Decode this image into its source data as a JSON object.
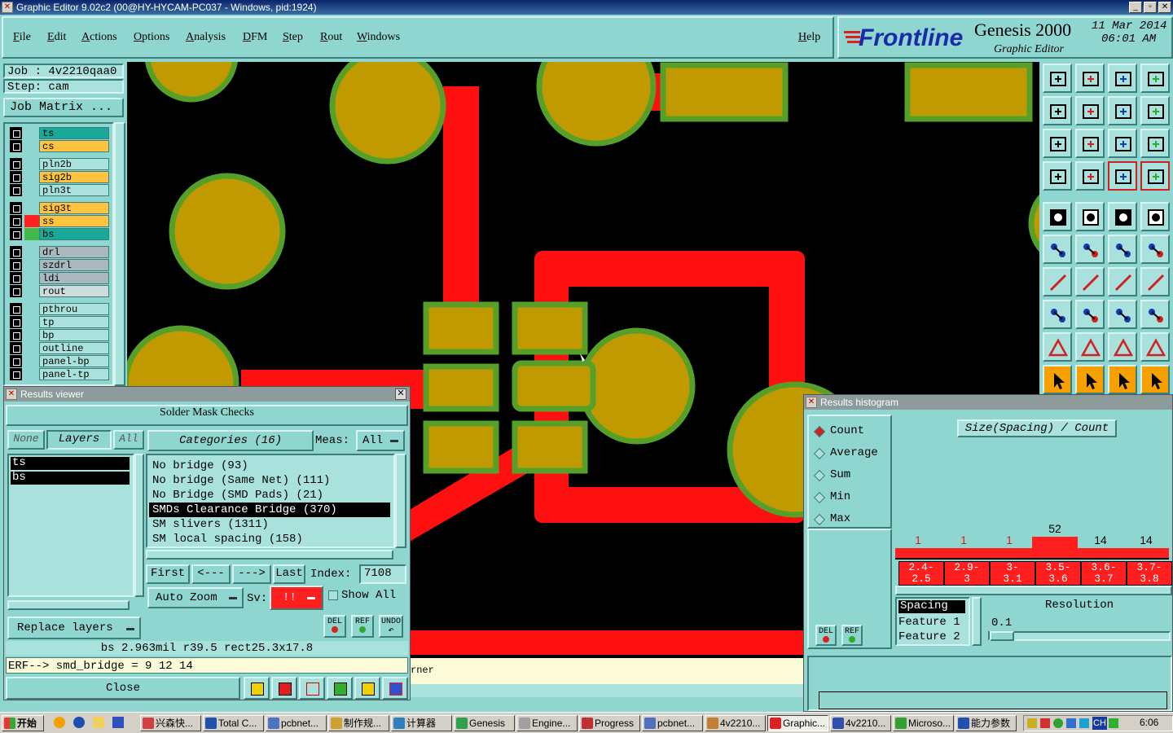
{
  "window": {
    "title": "Graphic Editor 9.02c2 (00@HY-HYCAM-PC037 - Windows, pid:1924)"
  },
  "menu": [
    "File",
    "Edit",
    "Actions",
    "Options",
    "Analysis",
    "DFM",
    "Step",
    "Rout",
    "Windows"
  ],
  "help_label": "Help",
  "brand": {
    "logo": "Frontline",
    "product": "Genesis 2000",
    "subtitle": "Graphic Editor",
    "date": "11 Mar 2014",
    "time": "06:01 AM"
  },
  "job": {
    "job_line": "Job : 4v2210qaa0",
    "step_line": "Step: cam",
    "matrix_label": "Job Matrix ..."
  },
  "layers": [
    {
      "name": "ts",
      "color": "#1aa898",
      "tag": "#8fd6d0"
    },
    {
      "name": "cs",
      "color": "#ffc340",
      "tag": "#8fd6d0"
    },
    {
      "name": "pln2b",
      "color": "#a9e2dd",
      "tag": "#8fd6d0"
    },
    {
      "name": "sig2b",
      "color": "#ffc340",
      "tag": "#8fd6d0"
    },
    {
      "name": "pln3t",
      "color": "#a9e2dd",
      "tag": "#8fd6d0"
    },
    {
      "name": "sig3t",
      "color": "#ffc340",
      "tag": "#8fd6d0"
    },
    {
      "name": "ss",
      "color": "#ffc340",
      "tag": "#ff2020"
    },
    {
      "name": "bs",
      "color": "#1aa898",
      "tag": "#44b84a"
    },
    {
      "name": "drl",
      "color": "#a8b8bc",
      "tag": "#8fd6d0"
    },
    {
      "name": "szdrl",
      "color": "#a8b8bc",
      "tag": "#8fd6d0"
    },
    {
      "name": "ldi",
      "color": "#a8b8bc",
      "tag": "#8fd6d0"
    },
    {
      "name": "rout",
      "color": "#d0dcdc",
      "tag": "#8fd6d0"
    },
    {
      "name": "pthrou",
      "color": "#a9e2dd",
      "tag": "#8fd6d0"
    },
    {
      "name": "tp",
      "color": "#a9e2dd",
      "tag": "#8fd6d0"
    },
    {
      "name": "bp",
      "color": "#a9e2dd",
      "tag": "#8fd6d0"
    },
    {
      "name": "outline",
      "color": "#a9e2dd",
      "tag": "#8fd6d0"
    },
    {
      "name": "panel-bp",
      "color": "#a9e2dd",
      "tag": "#8fd6d0"
    },
    {
      "name": "panel-tp",
      "color": "#a9e2dd",
      "tag": "#8fd6d0"
    }
  ],
  "results_viewer": {
    "title": "Results viewer",
    "header": "Solder Mask Checks",
    "none_label": "None",
    "layers_label": "Layers",
    "all_label": "All",
    "layer_items": [
      "ts",
      "bs"
    ],
    "categories_label": "Categories (16)",
    "meas_label": "Meas:",
    "meas_value": "All",
    "categories": [
      "No bridge (93)",
      "No bridge (Same Net) (111)",
      "No Bridge (SMD Pads) (21)",
      "SMDs Clearance Bridge (370)",
      "SM slivers (1311)",
      "SM local spacing (158)"
    ],
    "selected_category": 3,
    "first_label": "First",
    "prev_label": "<---",
    "next_label": "--->",
    "last_label": "Last",
    "index_label": "Index:",
    "index_value": "7108",
    "auto_zoom_label": "Auto Zoom",
    "sv_label": "Sv:",
    "sv_value": "!!",
    "show_all_label": "Show All",
    "replace_layers_label": "Replace layers",
    "del_label": "DEL",
    "ref_label": "REF",
    "undo_label": "UNDO",
    "status_line": "bs 2.963mil  r39.5  rect25.3x17.8",
    "erf_line": "ERF--> smd_bridge = 9 12 14",
    "close_label": "Close"
  },
  "canvas_text": {
    "corner_fragment": "rner"
  },
  "histogram": {
    "title": "Results histogram",
    "modes": [
      "Count",
      "Average",
      "Sum",
      "Min",
      "Max"
    ],
    "selected_mode": 0,
    "chart_title": "Size(Spacing) / Count",
    "del_label": "DEL",
    "ref_label": "REF",
    "list_items": [
      "Spacing",
      "Feature 1",
      "Feature 2"
    ],
    "resolution_label": "Resolution",
    "resolution_value": "0.1"
  },
  "chart_data": {
    "type": "bar",
    "title": "Size(Spacing) / Count",
    "categories": [
      "2.4-2.5",
      "2.9-3",
      "3-3.1",
      "3.5-3.6",
      "3.6-3.7",
      "3.7-3.8"
    ],
    "series": [
      {
        "values": [
          1,
          1,
          1,
          52,
          14,
          14
        ]
      }
    ],
    "data_labels": [
      "1",
      "1",
      "1",
      "52",
      "14",
      "14"
    ],
    "category_labels": [
      "2.4-\n2.5",
      "2.9-\n3",
      "3-\n3.1",
      "3.5-\n3.6",
      "3.6-\n3.7",
      "3.7-\n3.8"
    ]
  },
  "taskbar": {
    "start": "开始",
    "items": [
      "兴森快...",
      "Total C...",
      "pcbnet...",
      "制作规...",
      "计算器",
      "Genesis",
      "Engine...",
      "Progress",
      "pcbnet...",
      "4v2210...",
      "Graphic...",
      "4v2210...",
      "Microso...",
      "能力参数"
    ],
    "active_index": 10,
    "lang": "CH",
    "clock": "6:06"
  },
  "colors": {
    "bg": "#8fd6d0",
    "pad": "#c09a00",
    "pad_ring": "#56a02a",
    "trace": "#ff1010",
    "accent_red": "#ff1f1f"
  }
}
